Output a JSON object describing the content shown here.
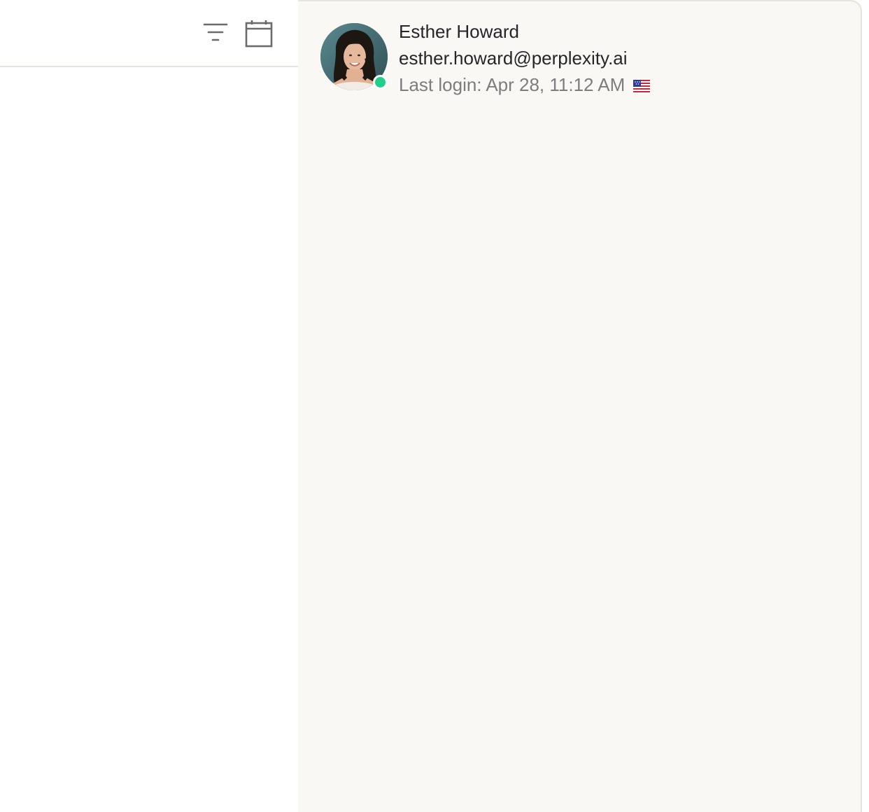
{
  "toolbar": {
    "filter_icon": "filter-icon",
    "calendar_icon": "calendar-icon"
  },
  "profile": {
    "name": "Esther Howard",
    "email": "esther.howard@perplexity.ai",
    "last_login_label": "Last login:",
    "last_login_value": "Apr 28, 11:12 AM",
    "country_flag_icon": "us-flag-icon",
    "status": "online",
    "status_color": "#1fcf8a",
    "avatar_icon": "user-avatar"
  },
  "colors": {
    "panel_background": "#f9f8f4",
    "divider": "#e6e5dc",
    "primary_text": "#26262a",
    "secondary_text": "#7d7d80"
  }
}
